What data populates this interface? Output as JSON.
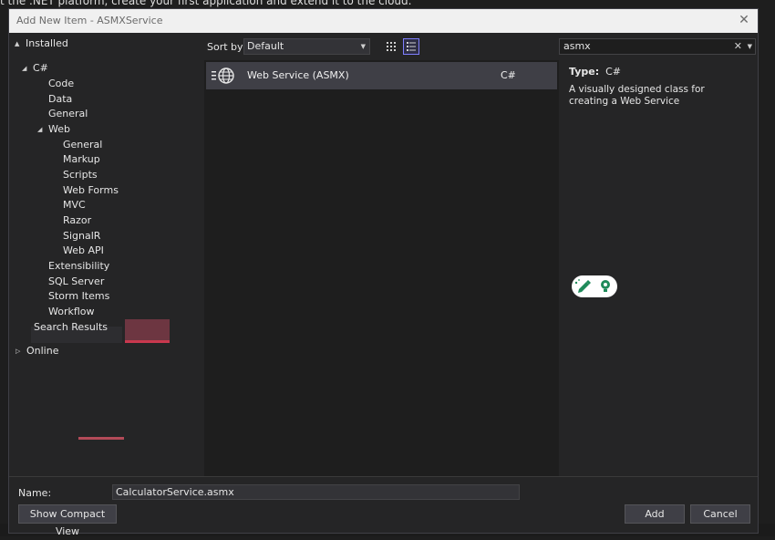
{
  "background": {
    "text": "t the .NET platform, create your first application and extend it to the cloud."
  },
  "dialog": {
    "title": "Add New Item - ASMXService",
    "close_icon": "close-icon"
  },
  "tree": {
    "installed": "Installed",
    "csharp": "C#",
    "code": "Code",
    "data": "Data",
    "general": "General",
    "web": "Web",
    "web_general": "General",
    "markup": "Markup",
    "scripts": "Scripts",
    "web_forms": "Web Forms",
    "mvc": "MVC",
    "razor": "Razor",
    "signalr": "SignalR",
    "web_api": "Web API",
    "extensibility": "Extensibility",
    "sql_server": "SQL Server",
    "storm_items": "Storm Items",
    "workflow": "Workflow",
    "search_results": "Search Results",
    "online": "Online"
  },
  "toolbar": {
    "sort_label": "Sort by:",
    "sort_value": "Default",
    "grid_view_icon": "grid-view-icon",
    "list_view_icon": "list-view-icon"
  },
  "search": {
    "value": "asmx"
  },
  "results": [
    {
      "name": "Web Service (ASMX)",
      "language": "C#",
      "icon": "web-service-globe-icon"
    }
  ],
  "details": {
    "type_label": "Type:",
    "type_value": "C#",
    "description": "A visually designed class for creating a Web Service"
  },
  "bottom": {
    "name_label": "Name:",
    "name_value": "CalculatorService.asmx",
    "compact_view": "Show Compact View",
    "add": "Add",
    "cancel": "Cancel"
  },
  "colors": {
    "accent": "#7f7fff",
    "selection": "#3f3f46"
  }
}
